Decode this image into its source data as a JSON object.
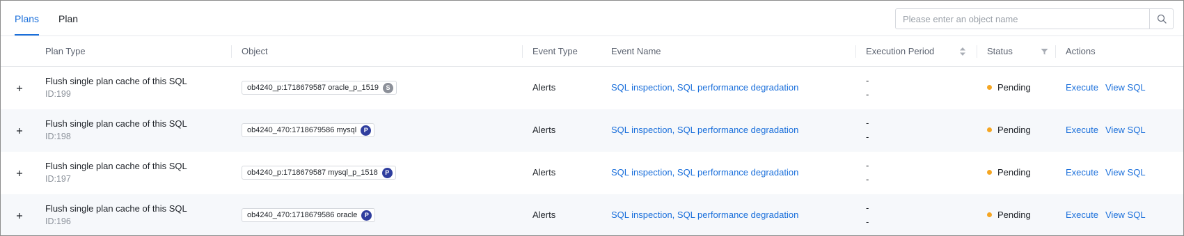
{
  "tabs": [
    {
      "label": "Plans",
      "active": true
    },
    {
      "label": "Plan",
      "active": false
    }
  ],
  "search": {
    "placeholder": "Please enter an object name",
    "value": ""
  },
  "columns": {
    "plan_type": "Plan Type",
    "object": "Object",
    "event_type": "Event Type",
    "event_name": "Event Name",
    "execution_period": "Execution Period",
    "status": "Status",
    "actions": "Actions"
  },
  "colors": {
    "accent": "#1a6fdb",
    "pending": "#f5a623",
    "badge_p": "#2f3e9e",
    "badge_s": "#8c9099"
  },
  "rows": [
    {
      "plan_type": "Flush single plan cache of this SQL",
      "id": "ID:199",
      "object": "ob4240_p:1718679587 oracle_p_1519",
      "badge": "S",
      "event_type": "Alerts",
      "event_name": "SQL inspection, SQL performance degradation",
      "period_start": "-",
      "period_end": "-",
      "status": "Pending",
      "action_execute": "Execute",
      "action_view": "View SQL"
    },
    {
      "plan_type": "Flush single plan cache of this SQL",
      "id": "ID:198",
      "object": "ob4240_470:1718679586 mysql",
      "badge": "P",
      "event_type": "Alerts",
      "event_name": "SQL inspection, SQL performance degradation",
      "period_start": "-",
      "period_end": "-",
      "status": "Pending",
      "action_execute": "Execute",
      "action_view": "View SQL"
    },
    {
      "plan_type": "Flush single plan cache of this SQL",
      "id": "ID:197",
      "object": "ob4240_p:1718679587 mysql_p_1518",
      "badge": "P",
      "event_type": "Alerts",
      "event_name": "SQL inspection, SQL performance degradation",
      "period_start": "-",
      "period_end": "-",
      "status": "Pending",
      "action_execute": "Execute",
      "action_view": "View SQL"
    },
    {
      "plan_type": "Flush single plan cache of this SQL",
      "id": "ID:196",
      "object": "ob4240_470:1718679586 oracle",
      "badge": "P",
      "event_type": "Alerts",
      "event_name": "SQL inspection, SQL performance degradation",
      "period_start": "-",
      "period_end": "-",
      "status": "Pending",
      "action_execute": "Execute",
      "action_view": "View SQL"
    }
  ]
}
